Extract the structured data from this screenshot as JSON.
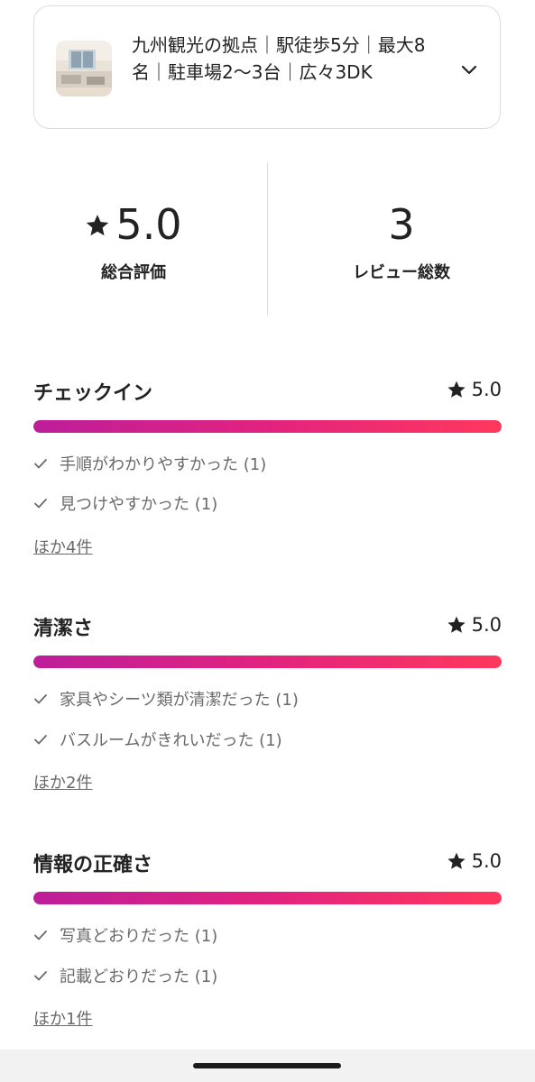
{
  "listing": {
    "title": "九州観光の拠点｜駅徒歩5分｜最大8名｜駐車場2〜3台｜広々3DK"
  },
  "summary": {
    "rating_value": "5.0",
    "rating_label": "総合評価",
    "review_count": "3",
    "review_count_label": "レビュー総数"
  },
  "categories": [
    {
      "title": "チェックイン",
      "score": "5.0",
      "fill": 1.0,
      "tags": [
        "手順がわかりやすかった (1)",
        "見つけやすかった (1)"
      ],
      "more": "ほか4件"
    },
    {
      "title": "清潔さ",
      "score": "5.0",
      "fill": 1.0,
      "tags": [
        "家具やシーツ類が清潔だった (1)",
        "バスルームがきれいだった (1)"
      ],
      "more": "ほか2件"
    },
    {
      "title": "情報の正確さ",
      "score": "5.0",
      "fill": 1.0,
      "tags": [
        "写真どおりだった (1)",
        "記載どおりだった (1)"
      ],
      "more": "ほか1件"
    }
  ],
  "colors": {
    "bar_gradient_start": "#bd1e9a",
    "bar_gradient_end": "#ff385c",
    "muted_text": "#6a6a6a"
  },
  "icons": {
    "star": "star-icon",
    "check": "check-icon",
    "chevron": "chevron-down-icon"
  }
}
